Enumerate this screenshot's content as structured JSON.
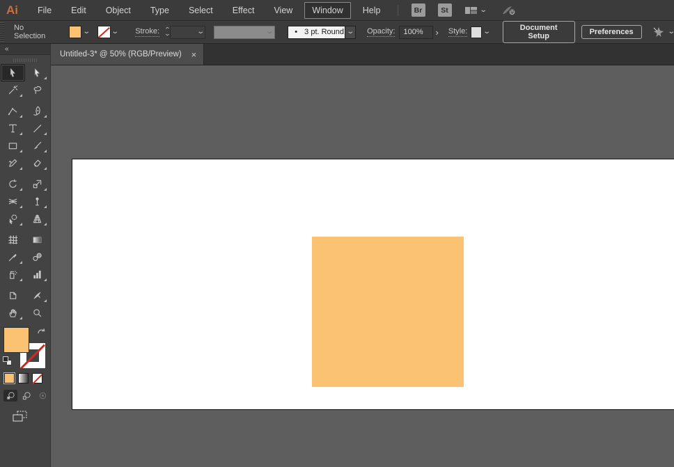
{
  "app": {
    "logo_text": "Ai"
  },
  "menu_bar": {
    "items": [
      "File",
      "Edit",
      "Object",
      "Type",
      "Select",
      "Effect",
      "View",
      "Window",
      "Help"
    ],
    "active_item": "Window",
    "bridge_button": "Br",
    "stock_button": "St"
  },
  "control_bar": {
    "selection_status": "No Selection",
    "stroke_label": "Stroke:",
    "brush_dot": "•",
    "brush_value": "3 pt. Round",
    "opacity_label": "Opacity:",
    "opacity_value": "100%",
    "opacity_arrow": "›",
    "style_label": "Style:",
    "document_setup_button": "Document Setup",
    "preferences_button": "Preferences"
  },
  "document_tab": {
    "title": "Untitled-3* @ 50% (RGB/Preview)",
    "close_glyph": "×"
  },
  "tools_panel": {
    "collapse_glyph": "«",
    "active_tool": "selection-tool",
    "tools": [
      "selection-tool",
      "direct-selection-tool",
      "magic-wand-tool",
      "lasso-tool",
      "pen-tool",
      "curvature-tool",
      "type-tool",
      "line-segment-tool",
      "rectangle-tool",
      "paintbrush-tool",
      "shaper-tool",
      "eraser-tool",
      "rotate-tool",
      "scale-tool",
      "width-tool",
      "puppet-warp-tool",
      "shape-builder-tool",
      "perspective-grid-tool",
      "mesh-tool",
      "gradient-tool",
      "eyedropper-tool",
      "blend-tool",
      "symbol-sprayer-tool",
      "column-graph-tool",
      "artboard-tool",
      "slice-tool",
      "hand-tool",
      "zoom-tool"
    ]
  },
  "colors": {
    "fill": "#FBC271",
    "stroke": "none",
    "none_indicator_red": "#CE2A23",
    "canvas_background": "#5E5E5E",
    "artboard_background": "#FFFFFF"
  },
  "canvas": {
    "artboard_object": {
      "type": "rectangle",
      "fill": "#FBC271"
    }
  }
}
